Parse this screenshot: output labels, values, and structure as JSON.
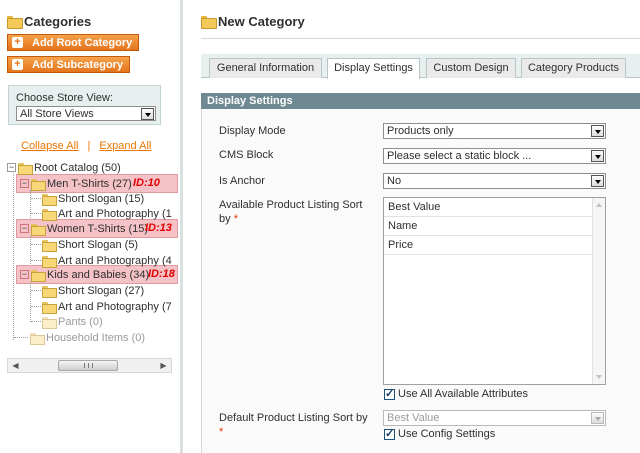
{
  "sidebar": {
    "title": "Categories",
    "add_root_label": "Add Root Category",
    "add_sub_label": "Add Subcategory",
    "store_view_label": "Choose Store View:",
    "store_view_selected": "All Store Views",
    "collapse_all": "Collapse All",
    "link_separator": "|",
    "expand_all": "Expand All",
    "tree": {
      "root": "Root Catalog (50)",
      "men": "Men T-Shirts (27)",
      "men_id": "ID:10",
      "men_short": "Short Slogan (15)",
      "men_art": "Art and Photography (1",
      "women": "Women T-Shirts (15)",
      "women_id": "ID:13",
      "women_short": "Short Slogan (5)",
      "women_art": "Art and Photography (4",
      "kids": "Kids and Babies (34)",
      "kids_id": "ID:18",
      "kids_short": "Short Slogan (27)",
      "kids_art": "Art and Photography (7",
      "kids_pants": "Pants (0)",
      "household": "Household Items (0)"
    }
  },
  "main": {
    "title": "New Category",
    "tabs": [
      {
        "label": "General Information"
      },
      {
        "label": "Display Settings"
      },
      {
        "label": "Custom Design"
      },
      {
        "label": "Category Products"
      }
    ],
    "panel_title": "Display Settings",
    "fields": {
      "display_mode_label": "Display Mode",
      "display_mode_value": "Products only",
      "cms_block_label": "CMS Block",
      "cms_block_value": "Please select a static block ...",
      "is_anchor_label": "Is Anchor",
      "is_anchor_value": "No",
      "sort_label_line1": "Available Product Listing Sort",
      "sort_label_line2": "by",
      "required_mark": "*",
      "sort_options": [
        "Best Value",
        "Name",
        "Price"
      ],
      "use_all_attributes": "Use All Available Attributes",
      "default_sort_label": "Default Product Listing Sort by",
      "default_sort_value": "Best Value",
      "use_config": "Use Config Settings"
    }
  },
  "colors": {
    "accent_orange": "#e4741c",
    "panel_header": "#6f8992",
    "highlight": "#e67882",
    "id_label": "#e30000"
  }
}
